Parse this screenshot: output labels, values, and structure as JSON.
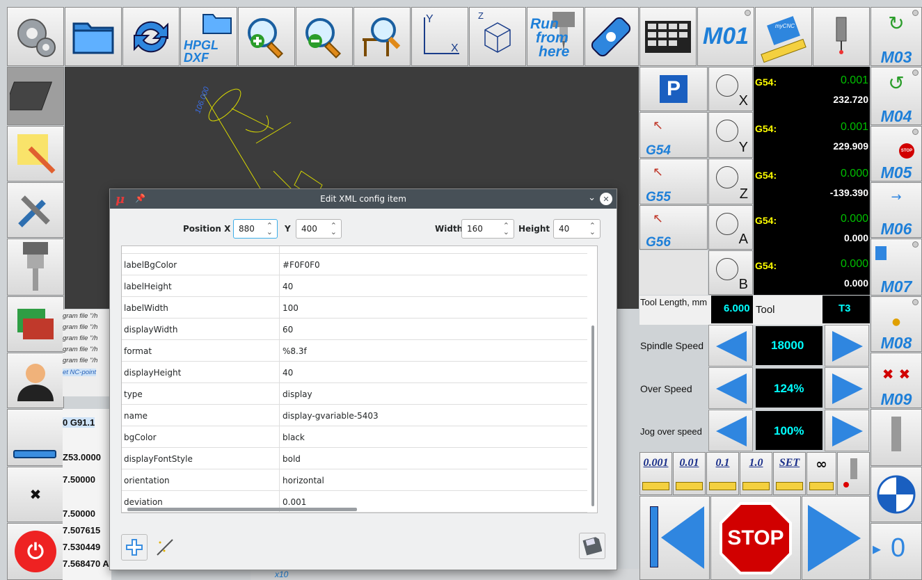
{
  "toolbar": {
    "hpgl_label": "HPGL",
    "dxf_label": "DXF",
    "axis_y": "Y",
    "axis_x": "X",
    "axis_z": "Z",
    "run_label_1": "Run",
    "run_label_2": "from",
    "run_label_3": "here",
    "m01": "M01",
    "mycnc": "myCNC"
  },
  "right_column": {
    "m03": "M03",
    "m04": "M04",
    "m05": "M05",
    "m06": "M06",
    "m07": "M07",
    "m08": "M08",
    "m09": "M09",
    "stop_badge": "STOP"
  },
  "wcs": {
    "g54": "G54",
    "g55": "G55",
    "g56": "G56",
    "p_label": "P"
  },
  "axes": {
    "x": "X",
    "y": "Y",
    "z": "Z",
    "a": "A",
    "b": "B"
  },
  "dro": [
    {
      "label": "G54:",
      "value1": "0.001",
      "value2": "232.720"
    },
    {
      "label": "G54:",
      "value1": "0.001",
      "value2": "229.909"
    },
    {
      "label": "G54:",
      "value1": "0.000",
      "value2": "-139.390"
    },
    {
      "label": "G54:",
      "value1": "0.000",
      "value2": "0.000"
    },
    {
      "label": "G54:",
      "value1": "0.000",
      "value2": "0.000"
    }
  ],
  "tool": {
    "length_label": "Tool Length, mm",
    "length_value": "6.000",
    "tool_label": "Tool",
    "tool_value": "T3"
  },
  "speeds": [
    {
      "label": "Spindle Speed",
      "value": "18000"
    },
    {
      "label": "Over Speed",
      "value": "124%"
    },
    {
      "label": "Jog over speed",
      "value": "100%"
    }
  ],
  "steps": [
    "0.001",
    "0.01",
    "0.1",
    "1.0",
    "SET",
    "∞"
  ],
  "stop_label": "STOP",
  "zero_label": "0",
  "canvas": {
    "dim_text": "106.000"
  },
  "log_lines": [
    "gram file \"/h",
    "gram file \"/h",
    "gram file \"/h",
    "gram file \"/h",
    "gram file \"/h",
    "et NC-point"
  ],
  "code_lines": [
    "0 G91.1",
    "Z53.0000",
    "7.50000",
    "7.50000",
    "7.507615",
    "7.530449",
    "7.568470 A1.412633"
  ],
  "x10_label": "x10",
  "dialog": {
    "title": "Edit XML config item",
    "pos_x_label": "Position X",
    "pos_x_value": "880",
    "y_label": "Y",
    "y_value": "400",
    "width_label": "Width",
    "width_value": "160",
    "height_label": "Height",
    "height_value": "40",
    "rows": [
      {
        "key": "labelBgColor",
        "value": "#F0F0F0"
      },
      {
        "key": "labelHeight",
        "value": "40"
      },
      {
        "key": "labelWidth",
        "value": "100"
      },
      {
        "key": "displayWidth",
        "value": "60"
      },
      {
        "key": "format",
        "value": "%8.3f"
      },
      {
        "key": "displayHeight",
        "value": "40"
      },
      {
        "key": "type",
        "value": "display"
      },
      {
        "key": "name",
        "value": "display-gvariable-5403"
      },
      {
        "key": "bgColor",
        "value": "black"
      },
      {
        "key": "displayFontStyle",
        "value": "bold"
      },
      {
        "key": "orientation",
        "value": "horizontal"
      },
      {
        "key": "deviation",
        "value": "0.001"
      }
    ]
  },
  "colors": {
    "accent": "#1e7fd8",
    "dro_green": "#00c000",
    "dro_yellow": "#ffff00",
    "dro_cyan": "#00ffff",
    "dialog_title": "#475057"
  }
}
